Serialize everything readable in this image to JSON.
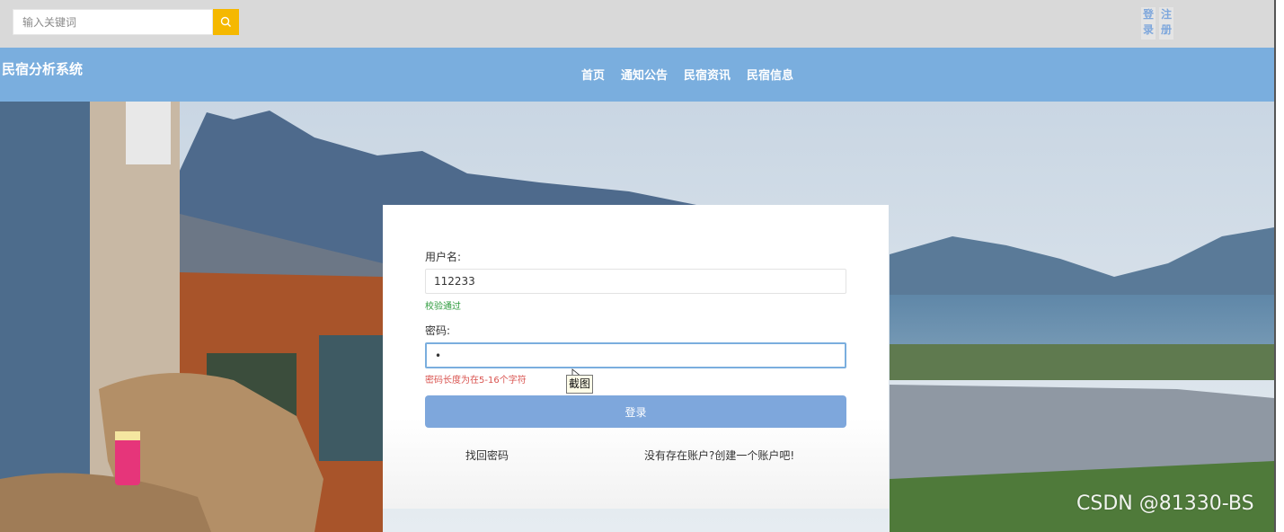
{
  "search": {
    "placeholder": "输入关键词"
  },
  "auth": {
    "login": "登录",
    "register": "注册"
  },
  "site": {
    "title": "民宿分析系统"
  },
  "nav": [
    "首页",
    "通知公告",
    "民宿资讯",
    "民宿信息"
  ],
  "form": {
    "username_label": "用户名:",
    "username_value": "112233",
    "username_hint": "校验通过",
    "password_label": "密码:",
    "password_value": "•",
    "password_hint": "密码长度为在5-16个字符",
    "submit": "登录",
    "forgot": "找回密码",
    "register_link": "没有存在账户?创建一个账户吧!"
  },
  "tooltip": "截图",
  "watermark": "CSDN @81330-BS",
  "colors": {
    "accent": "#7aaede",
    "search_button": "#f5b800",
    "ok": "#2e9b3d",
    "error": "#d9534f"
  }
}
